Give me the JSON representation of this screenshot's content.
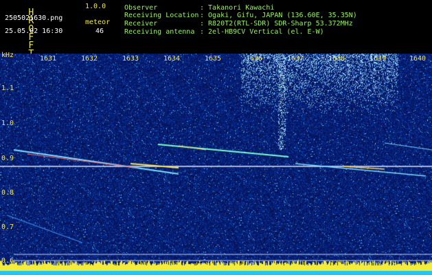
{
  "app": {
    "title_letters": [
      "H",
      "R",
      "O",
      "F",
      "F",
      "T"
    ],
    "version": "1.0.0",
    "filename": "2505021630.png",
    "datetime": "25.05.02 16:30",
    "meteor_label": "meteor",
    "meteor_count": "46"
  },
  "info": {
    "rows": [
      {
        "label": "Observer",
        "value": ": Takanori Kawachi"
      },
      {
        "label": "Receiving Location",
        "value": ": Ogaki, Gifu, JAPAN (136.60E, 35.35N)"
      },
      {
        "label": "Receiver",
        "value": ": R820T2(RTL-SDR) SDR-Sharp 53.372MHz"
      },
      {
        "label": "Receiving antenna",
        "value": ": 2el-HB9CV Vertical (el. E-W)"
      }
    ]
  },
  "plot": {
    "y_unit": "kHz",
    "x_ticks": [
      "1631",
      "1632",
      "1633",
      "1634",
      "1635",
      "1636",
      "1637",
      "1638",
      "1639",
      "1640"
    ],
    "y_ticks": [
      "1.1",
      "1.0",
      "0.9",
      "0.8",
      "0.7",
      "0.6"
    ],
    "colors": {
      "background": "#050b63",
      "accent_yellow": "#ffe94a",
      "carrier": "#dfe8ff"
    }
  }
}
